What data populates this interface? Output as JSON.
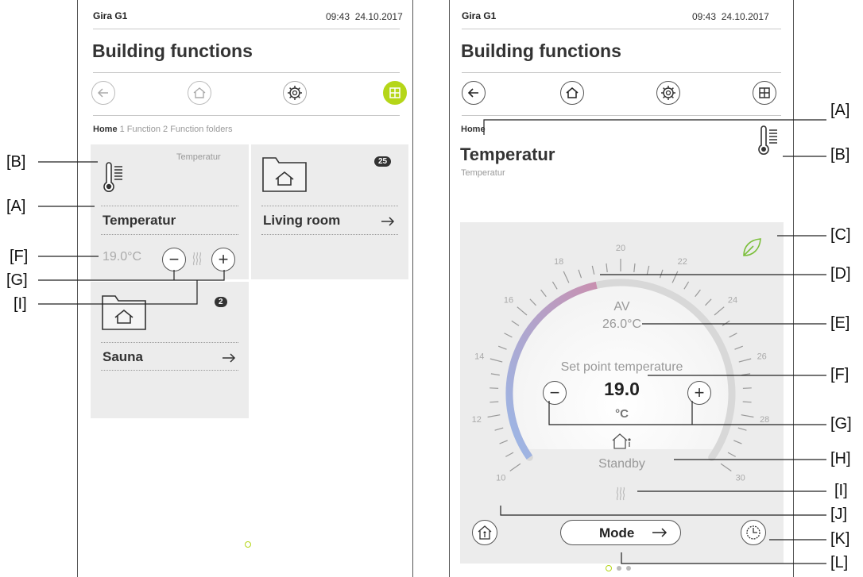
{
  "left": {
    "device_name": "Gira G1",
    "time": "09:43",
    "date": "24.10.2017",
    "title": "Building functions",
    "breadcrumb": {
      "home": "Home",
      "rest": " 1  Function  2  Function folders"
    },
    "tiles": {
      "temperature": {
        "caption": "Temperatur",
        "label": "Temperatur",
        "value": "19.0°C"
      },
      "living_room": {
        "label": "Living room",
        "badge": "25"
      },
      "sauna": {
        "label": "Sauna",
        "badge": "2"
      }
    }
  },
  "right": {
    "device_name": "Gira G1",
    "time": "09:43",
    "date": "24.10.2017",
    "title": "Building functions",
    "breadcrumb": "Home",
    "function_title": "Temperatur",
    "function_subtitle": "Temperatur",
    "dial": {
      "ticks": [
        "10",
        "12",
        "14",
        "16",
        "18",
        "20",
        "22",
        "24",
        "26",
        "28",
        "30"
      ],
      "actual_label": "AV",
      "actual_value": "26.0°C",
      "setpoint_label": "Set point temperature",
      "setpoint_value": "19.0",
      "unit": "°C",
      "mode_status": "Standby",
      "setpoint": 19.0,
      "range": [
        10,
        30
      ]
    },
    "mode_button": "Mode"
  },
  "callouts": {
    "A": "[A]",
    "B": "[B]",
    "C": "[C]",
    "D": "[D]",
    "E": "[E]",
    "F": "[F]",
    "G": "[G]",
    "H": "[H]",
    "I": "[I]",
    "J": "[J]",
    "K": "[K]",
    "L": "[L]"
  },
  "colors": {
    "accent": "#b5d618",
    "heat_start": "#9ab8e8",
    "heat_end": "#c890b0",
    "track": "#d8d8d8"
  }
}
